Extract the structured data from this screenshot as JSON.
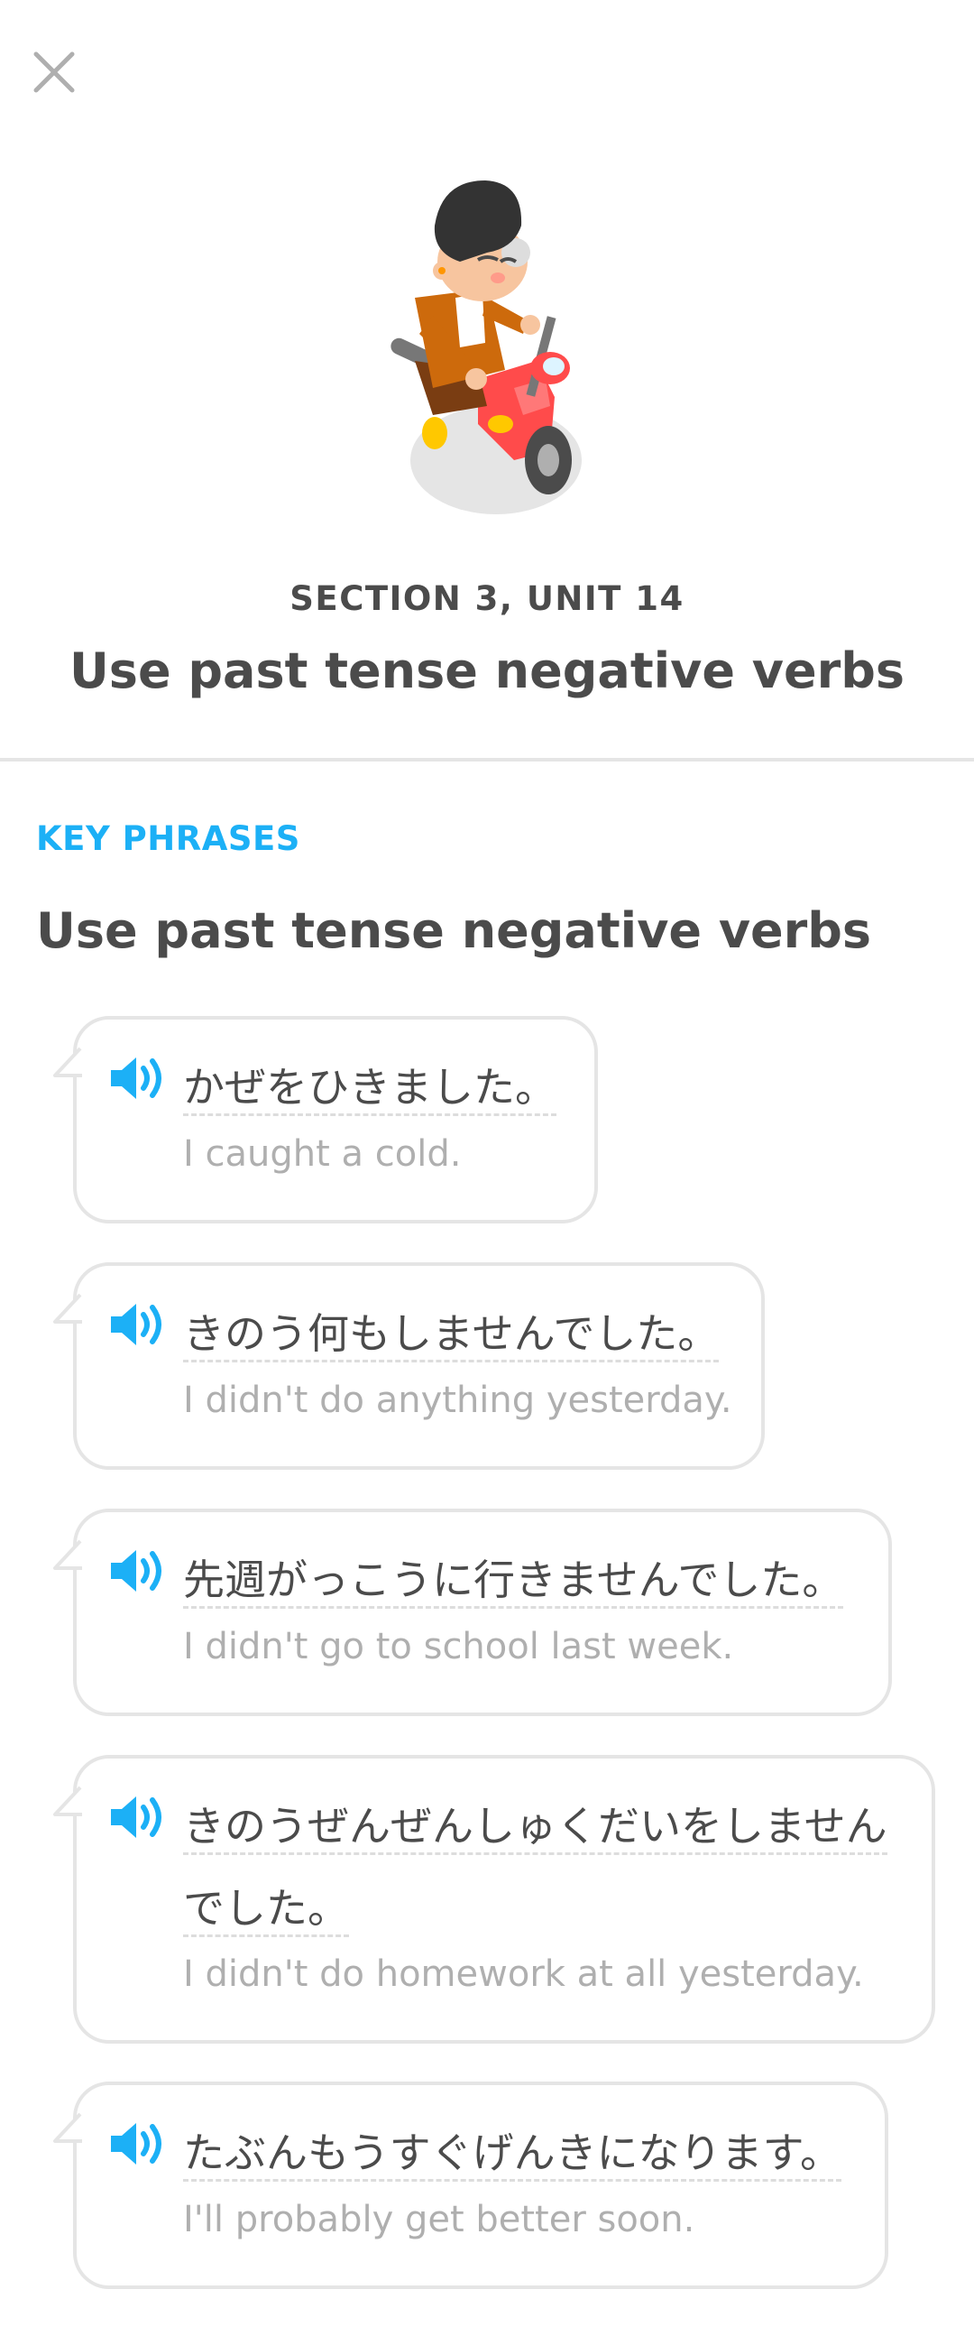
{
  "header": {
    "close_icon": "close-icon",
    "section_label": "SECTION 3, UNIT 14",
    "unit_title": "Use past tense negative verbs"
  },
  "key_phrases": {
    "label": "KEY PHRASES",
    "title": "Use past tense negative verbs",
    "speaker_icon": "speaker-icon",
    "phrases": [
      {
        "jp": "かぜをひきました。",
        "en": "I caught a cold."
      },
      {
        "jp": "きのう何もしませんでした。",
        "en": "I didn't do anything yesterday."
      },
      {
        "jp": "先週がっこうに行きませんでした。",
        "en": "I didn't go to school last week."
      },
      {
        "jp_line1": "きのうぜんぜんしゅくだいをしません",
        "jp_line2": "でした。",
        "en": "I didn't do homework at all yesterday."
      },
      {
        "jp": "たぶんもうすぐげんきになります。",
        "en": "I'll probably get better soon."
      }
    ]
  },
  "colors": {
    "accent": "#1cb0f6",
    "text": "#4b4b4b",
    "muted": "#afafaf",
    "border": "#e5e5e5"
  }
}
